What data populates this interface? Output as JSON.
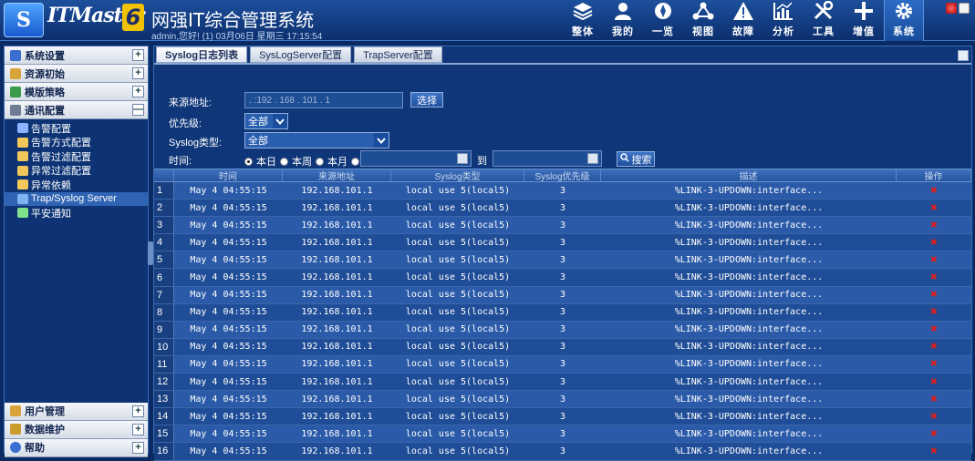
{
  "app": {
    "logo_text": "ITMaster",
    "logo_version": "6",
    "title": "网强IT综合管理系统",
    "welcome": "admin,您好! (1) 03月06日 星期三 17:15:54"
  },
  "topnav": [
    {
      "label": "整体",
      "icon": "layers-icon"
    },
    {
      "label": "我的",
      "icon": "user-icon"
    },
    {
      "label": "一览",
      "icon": "overview-icon"
    },
    {
      "label": "视图",
      "icon": "topology-icon"
    },
    {
      "label": "故障",
      "icon": "warning-icon"
    },
    {
      "label": "分析",
      "icon": "chart-icon"
    },
    {
      "label": "工具",
      "icon": "tools-icon"
    },
    {
      "label": "增值",
      "icon": "plus-icon"
    },
    {
      "label": "系统",
      "icon": "gear-icon",
      "active": true
    }
  ],
  "sidebar": {
    "groups_top": [
      {
        "label": "系统设置",
        "toggle": "+"
      },
      {
        "label": "资源初始",
        "toggle": "+"
      },
      {
        "label": "模版策略",
        "toggle": "+"
      },
      {
        "label": "通讯配置",
        "toggle": "—"
      }
    ],
    "sub_items": [
      {
        "label": "告警配置",
        "color": "#8ab4ff"
      },
      {
        "label": "告警方式配置",
        "color": "#f2c75a"
      },
      {
        "label": "告警过滤配置",
        "color": "#f2c75a"
      },
      {
        "label": "异常过滤配置",
        "color": "#f2c75a"
      },
      {
        "label": "异常依赖",
        "color": "#f2c75a"
      },
      {
        "label": "Trap/Syslog Server",
        "color": "#7fb2f0",
        "active": true
      },
      {
        "label": "平安通知",
        "color": "#7fe28a"
      }
    ],
    "groups_bottom": [
      {
        "label": "用户管理",
        "toggle": "+"
      },
      {
        "label": "数据维护",
        "toggle": "+"
      },
      {
        "label": "帮助",
        "toggle": "+"
      }
    ]
  },
  "tabs": [
    {
      "label": "Syslog日志列表",
      "active": true
    },
    {
      "label": "SysLogServer配置"
    },
    {
      "label": "TrapServer配置"
    }
  ],
  "form": {
    "source_label": "来源地址:",
    "source_value": "  . :192 . 168 . 101 . 1",
    "select_button": "选择",
    "priority_label": "优先级:",
    "priority_value": "全部",
    "type_label": "Syslog类型:",
    "type_value": "全部",
    "time_label": "时间:",
    "radio_today": "本日",
    "radio_week": "本周",
    "radio_month": "本月",
    "to_label": "到",
    "search_button": "搜索"
  },
  "table": {
    "headers": [
      "",
      "时间",
      "来源地址",
      "Syslog类型",
      "Syslog优先级",
      "描述",
      "操作"
    ],
    "rows": [
      {
        "n": "1",
        "time": "May 4 04:55:15",
        "src": "192.168.101.1",
        "type": "local use 5(local5)",
        "pri": "3",
        "desc": "%LINK-3-UPDOWN:interface..."
      },
      {
        "n": "2",
        "time": "May 4 04:55:15",
        "src": "192.168.101.1",
        "type": "local use 5(local5)",
        "pri": "3",
        "desc": "%LINK-3-UPDOWN:interface..."
      },
      {
        "n": "3",
        "time": "May 4 04:55:15",
        "src": "192.168.101.1",
        "type": "local use 5(local5)",
        "pri": "3",
        "desc": "%LINK-3-UPDOWN:interface..."
      },
      {
        "n": "4",
        "time": "May 4 04:55:15",
        "src": "192.168.101.1",
        "type": "local use 5(local5)",
        "pri": "3",
        "desc": "%LINK-3-UPDOWN:interface..."
      },
      {
        "n": "5",
        "time": "May 4 04:55:15",
        "src": "192.168.101.1",
        "type": "local use 5(local5)",
        "pri": "3",
        "desc": "%LINK-3-UPDOWN:interface..."
      },
      {
        "n": "6",
        "time": "May 4 04:55:15",
        "src": "192.168.101.1",
        "type": "local use 5(local5)",
        "pri": "3",
        "desc": "%LINK-3-UPDOWN:interface..."
      },
      {
        "n": "7",
        "time": "May 4 04:55:15",
        "src": "192.168.101.1",
        "type": "local use 5(local5)",
        "pri": "3",
        "desc": "%LINK-3-UPDOWN:interface..."
      },
      {
        "n": "8",
        "time": "May 4 04:55:15",
        "src": "192.168.101.1",
        "type": "local use 5(local5)",
        "pri": "3",
        "desc": "%LINK-3-UPDOWN:interface..."
      },
      {
        "n": "9",
        "time": "May 4 04:55:15",
        "src": "192.168.101.1",
        "type": "local use 5(local5)",
        "pri": "3",
        "desc": "%LINK-3-UPDOWN:interface..."
      },
      {
        "n": "10",
        "time": "May 4 04:55:15",
        "src": "192.168.101.1",
        "type": "local use 5(local5)",
        "pri": "3",
        "desc": "%LINK-3-UPDOWN:interface..."
      },
      {
        "n": "11",
        "time": "May 4 04:55:15",
        "src": "192.168.101.1",
        "type": "local use 5(local5)",
        "pri": "3",
        "desc": "%LINK-3-UPDOWN:interface..."
      },
      {
        "n": "12",
        "time": "May 4 04:55:15",
        "src": "192.168.101.1",
        "type": "local use 5(local5)",
        "pri": "3",
        "desc": "%LINK-3-UPDOWN:interface..."
      },
      {
        "n": "13",
        "time": "May 4 04:55:15",
        "src": "192.168.101.1",
        "type": "local use 5(local5)",
        "pri": "3",
        "desc": "%LINK-3-UPDOWN:interface..."
      },
      {
        "n": "14",
        "time": "May 4 04:55:15",
        "src": "192.168.101.1",
        "type": "local use 5(local5)",
        "pri": "3",
        "desc": "%LINK-3-UPDOWN:interface..."
      },
      {
        "n": "15",
        "time": "May 4 04:55:15",
        "src": "192.168.101.1",
        "type": "local use 5(local5)",
        "pri": "3",
        "desc": "%LINK-3-UPDOWN:interface..."
      },
      {
        "n": "16",
        "time": "May 4 04:55:15",
        "src": "192.168.101.1",
        "type": "local use 5(local5)",
        "pri": "3",
        "desc": "%LINK-3-UPDOWN:interface..."
      }
    ],
    "delete_glyph": "✖"
  },
  "colors": {
    "background": "#0a2a63",
    "row_odd": "#2a5aa8",
    "row_even": "#1f4d97",
    "delete": "#e0201b"
  }
}
